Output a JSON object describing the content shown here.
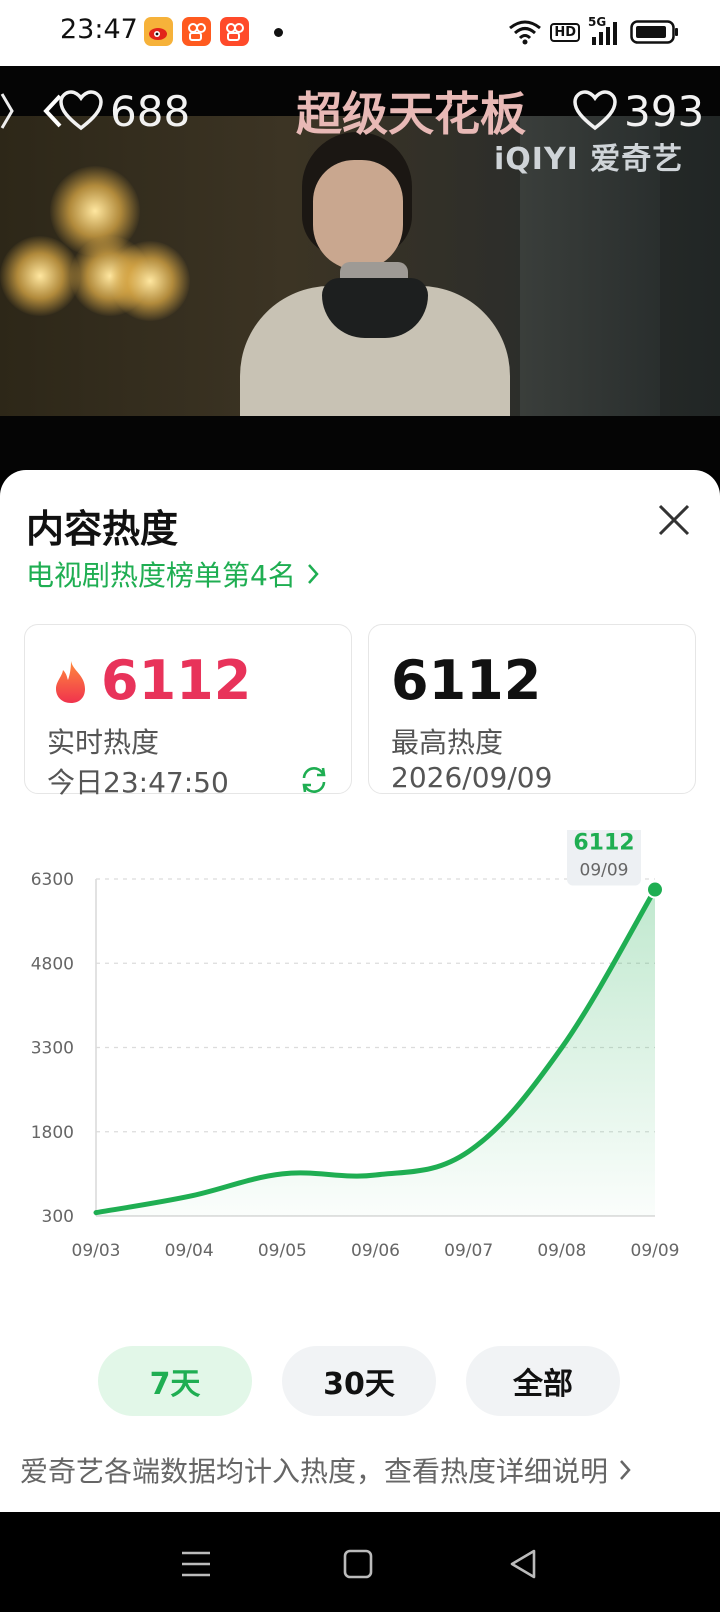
{
  "status_bar": {
    "time": "23:47",
    "hd_label": "HD",
    "network_label": "5G"
  },
  "video": {
    "left_like_count": "688",
    "right_like_count": "393",
    "banner_title": "超级天花板",
    "watermark": "iQIYI 爱奇艺"
  },
  "panel": {
    "title": "内容热度",
    "rank_link": "电视剧热度榜单第4名"
  },
  "realtime_card": {
    "value": "6112",
    "label": "实时热度",
    "timestamp": "今日23:47:50",
    "value_color": "#e8335a"
  },
  "peak_card": {
    "value": "6112",
    "label": "最高热度",
    "date": "2026/09/09"
  },
  "chart_data": {
    "type": "area",
    "categories": [
      "09/03",
      "09/04",
      "09/05",
      "09/06",
      "09/07",
      "09/08",
      "09/09"
    ],
    "values": [
      360,
      650,
      1050,
      1030,
      1450,
      3300,
      6112
    ],
    "y_ticks": [
      300,
      1800,
      3300,
      4800,
      6300
    ],
    "ylim": [
      300,
      6300
    ],
    "grid": true,
    "line_color": "#1fae52",
    "tooltip": {
      "value": "6112",
      "date": "09/09"
    }
  },
  "range_tabs": [
    {
      "label": "7天",
      "active": true
    },
    {
      "label": "30天",
      "active": false
    },
    {
      "label": "全部",
      "active": false
    }
  ],
  "footer": {
    "link_text": "爱奇艺各端数据均计入热度，查看热度详细说明"
  },
  "icons": {
    "close": "close-icon",
    "flame": "flame-icon",
    "refresh": "refresh-icon",
    "chevron": "chevron-right-icon",
    "nav_menu": "menu-icon",
    "nav_home": "home-square-icon",
    "nav_back": "back-triangle-icon"
  }
}
